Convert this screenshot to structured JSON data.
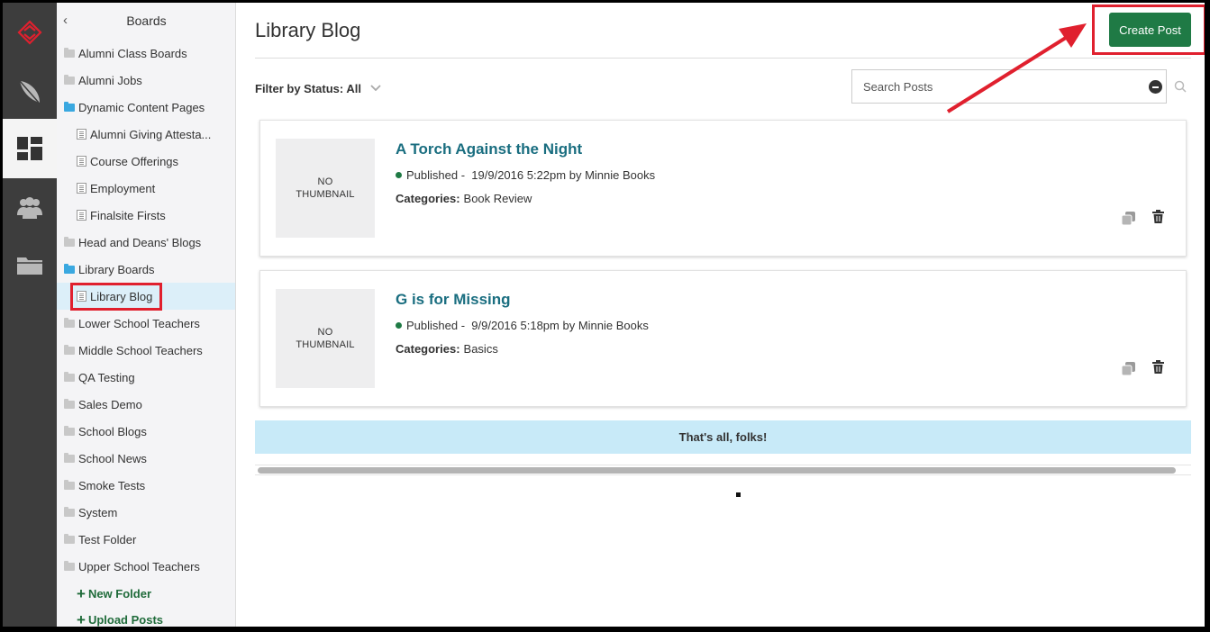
{
  "sidebar": {
    "title": "Boards",
    "back_icon": "chevron-left-icon",
    "items": [
      {
        "label": "Alumni Class Boards",
        "type": "folder"
      },
      {
        "label": "Alumni Jobs",
        "type": "folder"
      },
      {
        "label": "Dynamic Content Pages",
        "type": "folder-open"
      },
      {
        "label": "Alumni Giving Attesta...",
        "type": "page"
      },
      {
        "label": "Course Offerings",
        "type": "page"
      },
      {
        "label": "Employment",
        "type": "page"
      },
      {
        "label": "Finalsite Firsts",
        "type": "page"
      },
      {
        "label": "Head and Deans' Blogs",
        "type": "folder"
      },
      {
        "label": "Library Boards",
        "type": "folder-open"
      },
      {
        "label": "Library Blog",
        "type": "page",
        "selected": true
      },
      {
        "label": "Lower School Teachers",
        "type": "folder"
      },
      {
        "label": "Middle School Teachers",
        "type": "folder"
      },
      {
        "label": "QA Testing",
        "type": "folder"
      },
      {
        "label": "Sales Demo",
        "type": "folder"
      },
      {
        "label": "School Blogs",
        "type": "folder"
      },
      {
        "label": "School News",
        "type": "folder"
      },
      {
        "label": "Smoke Tests",
        "type": "folder"
      },
      {
        "label": "System",
        "type": "folder"
      },
      {
        "label": "Test Folder",
        "type": "folder"
      },
      {
        "label": "Upper School Teachers",
        "type": "folder"
      }
    ],
    "new_folder": "New Folder",
    "upload_posts": "Upload Posts"
  },
  "rail": {
    "items": [
      "logo-icon",
      "feather-icon",
      "dashboard-icon",
      "users-icon",
      "folder-icon"
    ],
    "active_index": 2
  },
  "main": {
    "title": "Library Blog",
    "create_button": "Create Post",
    "filter_label": "Filter by Status: All",
    "search_placeholder": "Search Posts",
    "posts": [
      {
        "thumbnail": "NO THUMBNAIL",
        "title": "A Torch Against the Night",
        "status": "Published -",
        "date": "19/9/2016 5:22pm",
        "by": "by",
        "author": "Minnie Books",
        "categories_label": "Categories:",
        "categories": "Book Review"
      },
      {
        "thumbnail": "NO THUMBNAIL",
        "title": "G is for Missing",
        "status": "Published -",
        "date": "9/9/2016 5:18pm",
        "by": "by",
        "author": "Minnie Books",
        "categories_label": "Categories:",
        "categories": "Basics"
      }
    ],
    "end_message": "That's all, folks!"
  },
  "colors": {
    "accent_green": "#1f7a45",
    "annotation_red": "#e0202e",
    "title_teal": "#1a6e80",
    "banner_blue": "#c8eaf8"
  }
}
